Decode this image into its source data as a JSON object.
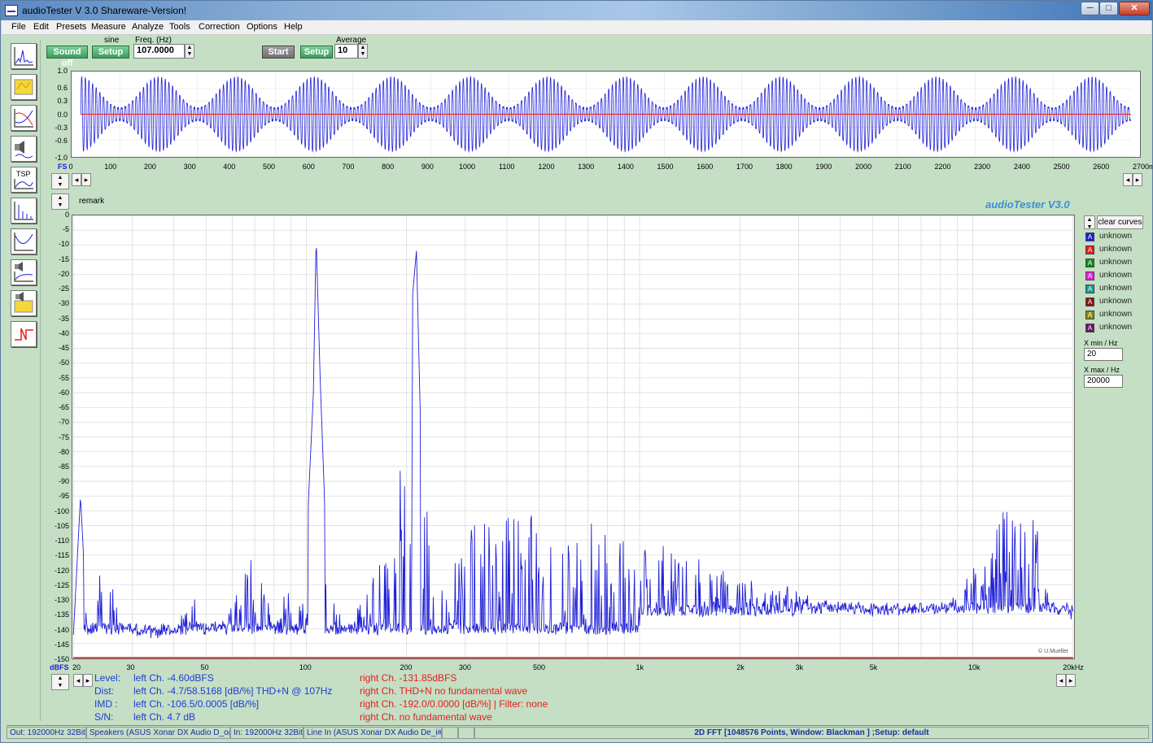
{
  "window": {
    "title": "audioTester  V 3.0 Shareware-Version!",
    "min": "─",
    "max": "□",
    "close": "✕"
  },
  "menu": [
    "File",
    "Edit",
    "Presets",
    "Measure",
    "Analyze",
    "Tools",
    "Correction",
    "Options",
    "Help"
  ],
  "toolbar": {
    "sound_off": "Sound off",
    "waveform_label": "sine",
    "setup1": "Setup",
    "freq_label": "Freq. (Hz)",
    "freq_value": "107.0000",
    "start": "Start",
    "setup2": "Setup",
    "average_label": "Average",
    "average_value": "10"
  },
  "waveform": {
    "y_ticks": [
      "1.0",
      "0.6",
      "0.3",
      "0.0",
      "-0.3",
      "-0.6",
      "-1.0"
    ],
    "x_ticks": [
      "0",
      "100",
      "200",
      "300",
      "400",
      "500",
      "600",
      "700",
      "800",
      "900",
      "1000",
      "1100",
      "1200",
      "1300",
      "1400",
      "1500",
      "1600",
      "1700",
      "1800",
      "1900",
      "2000",
      "2100",
      "2200",
      "2300",
      "2400",
      "2500",
      "2600",
      "2700ms"
    ],
    "fs": "FS",
    "signal_freq_hz": 107,
    "beat_period_ms": 200,
    "duration_ms": 2700
  },
  "remark": "remark",
  "brand": "audioTester  V3.0",
  "spectrum": {
    "y_ticks": [
      "0",
      "-5",
      "-10",
      "-15",
      "-20",
      "-25",
      "-30",
      "-35",
      "-40",
      "-45",
      "-50",
      "-55",
      "-60",
      "-65",
      "-70",
      "-75",
      "-80",
      "-85",
      "-90",
      "-95",
      "-100",
      "-105",
      "-110",
      "-115",
      "-120",
      "-125",
      "-130",
      "-135",
      "-140",
      "-145",
      "-150"
    ],
    "y_unit": "dBFS",
    "x_ticks": [
      "20",
      "30",
      "50",
      "100",
      "200",
      "300",
      "500",
      "1k",
      "2k",
      "3k",
      "5k",
      "10k",
      "20kHz"
    ],
    "copyright": "© U.Mueller"
  },
  "chart_data": {
    "type": "line",
    "xscale": "log",
    "xlim": [
      20,
      20000
    ],
    "ylim": [
      -150,
      0
    ],
    "ylabel": "dBFS",
    "grid": true,
    "series": [
      {
        "color": "#1f1fd8",
        "points": [
          [
            20,
            -142
          ],
          [
            21,
            -95
          ],
          [
            22,
            -140
          ],
          [
            25,
            -112
          ],
          [
            28,
            -140
          ],
          [
            32,
            -145
          ],
          [
            40,
            -145
          ],
          [
            45,
            -125
          ],
          [
            50,
            -140
          ],
          [
            60,
            -132
          ],
          [
            70,
            -110
          ],
          [
            80,
            -138
          ],
          [
            90,
            -125
          ],
          [
            100,
            -112
          ],
          [
            105,
            -60
          ],
          [
            107,
            -7
          ],
          [
            110,
            -55
          ],
          [
            115,
            -115
          ],
          [
            130,
            -140
          ],
          [
            180,
            -110
          ],
          [
            214,
            -12
          ],
          [
            220,
            -70
          ],
          [
            240,
            -130
          ],
          [
            300,
            -105
          ],
          [
            400,
            -100
          ],
          [
            500,
            -100
          ],
          [
            700,
            -105
          ],
          [
            1000,
            -110
          ],
          [
            1500,
            -115
          ],
          [
            2000,
            -125
          ],
          [
            3000,
            -128
          ],
          [
            5000,
            -135
          ],
          [
            8000,
            -135
          ],
          [
            10000,
            -120
          ],
          [
            12000,
            -100
          ],
          [
            15000,
            -100
          ],
          [
            18000,
            -135
          ],
          [
            20000,
            -142
          ]
        ]
      }
    ]
  },
  "legend": {
    "clear": "clear curves",
    "items": [
      {
        "label": "unknown",
        "color": "#1f1fd8"
      },
      {
        "label": "unknown",
        "color": "#e81c1c"
      },
      {
        "label": "unknown",
        "color": "#138a13"
      },
      {
        "label": "unknown",
        "color": "#e81ce8"
      },
      {
        "label": "unknown",
        "color": "#1c9a9a"
      },
      {
        "label": "unknown",
        "color": "#8a1313"
      },
      {
        "label": "unknown",
        "color": "#8a8a13"
      },
      {
        "label": "unknown",
        "color": "#6a136a"
      }
    ],
    "xmin_label": "X min / Hz",
    "xmin_value": "20",
    "xmax_label": "X max / Hz",
    "xmax_value": "20000"
  },
  "measure": {
    "level_label": "Level:",
    "level_left": "left Ch. -4.60dBFS",
    "level_right": "right Ch. -131.85dBFS",
    "dist_label": "Dist:",
    "dist_left": "left Ch. -4.7/58.5168 [dB/%] THD+N  @ 107Hz",
    "dist_right": "right Ch. THD+N  no fundamental wave",
    "imd_label": "IMD  :",
    "imd_left": "left Ch. -106.5/0.0005 [dB/%]",
    "imd_right": "right Ch. -192.0/0.0000 [dB/%] |   Filter: none",
    "sn_label": "S/N:",
    "sn_left": "left Ch. 4.7 dB",
    "sn_right": "right Ch.  no fundamental wave"
  },
  "status": {
    "out": "Out: 192000Hz 32Bit",
    "out_dev": "Speakers (ASUS Xonar DX Audio D_o#0",
    "in": "In: 192000Hz 32Bit",
    "in_dev": "Line In (ASUS Xonar DX Audio De_i#3",
    "fft": "2D FFT [1048576 Points, Window: Blackman ]  ;Setup:  default"
  }
}
